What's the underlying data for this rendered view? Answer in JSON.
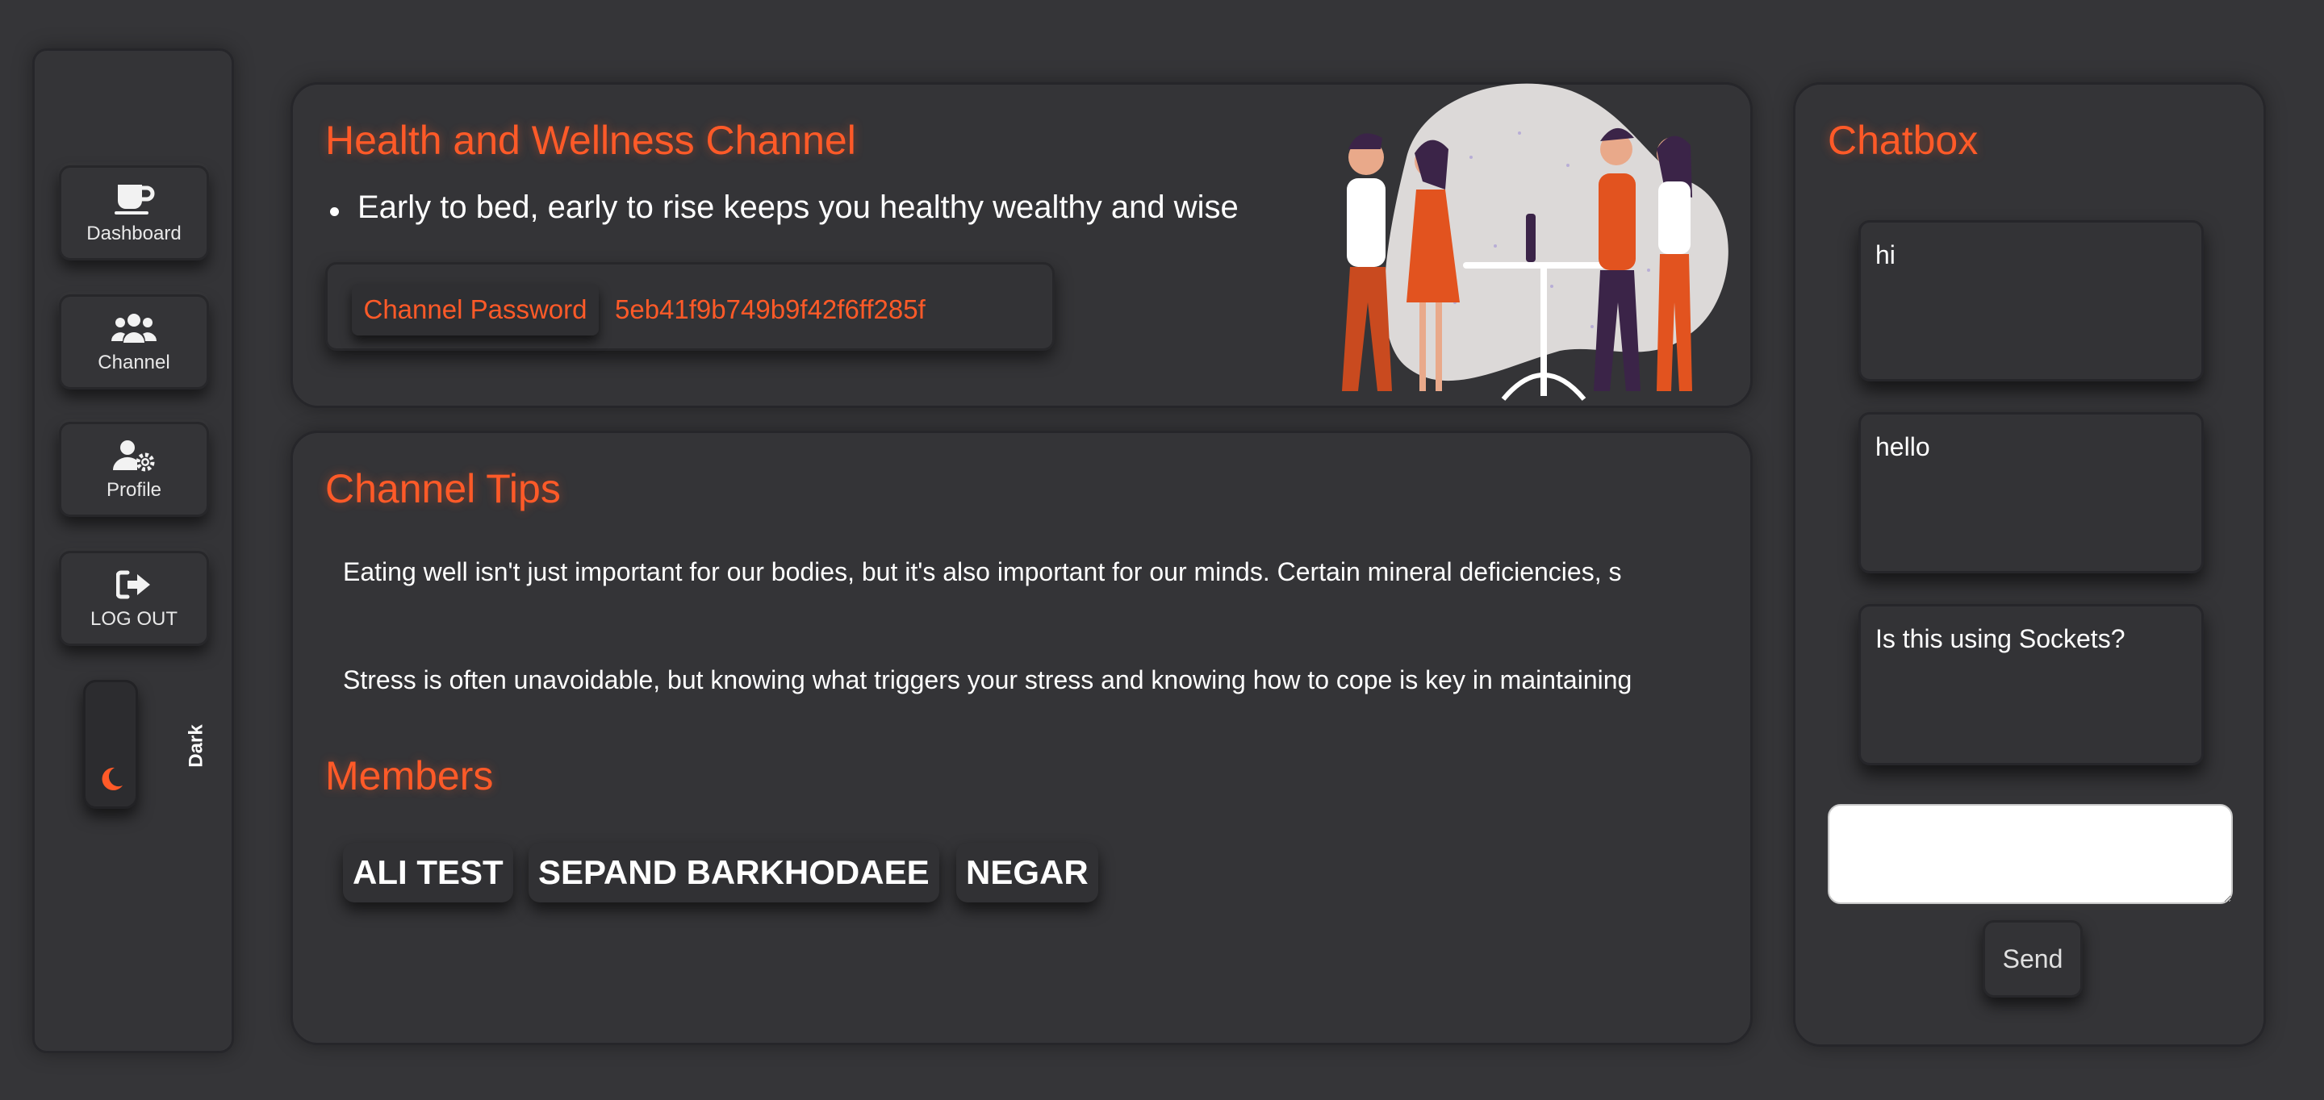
{
  "sidebar": {
    "items": [
      {
        "label": "Dashboard",
        "icon": "coffee-cup-icon"
      },
      {
        "label": "Channel",
        "icon": "users-icon"
      },
      {
        "label": "Profile",
        "icon": "user-gear-icon"
      },
      {
        "label": "LOG OUT",
        "icon": "sign-out-icon"
      }
    ],
    "theme_label": "Dark",
    "theme_icon": "moon-icon"
  },
  "channel": {
    "title": "Health and Wellness Channel",
    "tip": "Early to bed, early to rise keeps you healthy wealthy and wise",
    "password_label": "Channel Password",
    "password_value": "5eb41f9b749b9f42f6ff285f"
  },
  "tips": {
    "title": "Channel Tips",
    "items": [
      "Eating well isn't just important for our bodies, but it's also important for our minds. Certain mineral deficiencies, s",
      "Stress is often unavoidable, but knowing what triggers your stress and knowing how to cope is key in maintaining"
    ]
  },
  "members": {
    "title": "Members",
    "names": [
      "ALI TEST",
      "SEPAND BARKHODAEE",
      "NEGAR"
    ]
  },
  "chat": {
    "title": "Chatbox",
    "messages": [
      "hi",
      "hello",
      "Is this using Sockets?"
    ],
    "input_value": "",
    "send_label": "Send"
  },
  "colors": {
    "accent": "#ff5a28",
    "background": "#353538",
    "panel": "#343437"
  }
}
